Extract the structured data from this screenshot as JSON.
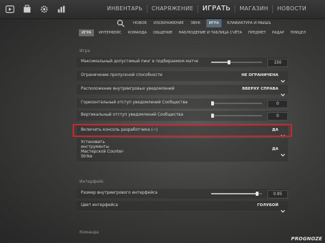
{
  "topbar": {
    "icons": [
      "play-icon",
      "inventory-box-icon",
      "gear-icon",
      "chart-icon"
    ],
    "nav": [
      "ИНВЕНТАРЬ",
      "СНАРЯЖЕНИЕ",
      "ИГРАТЬ",
      "МАГАЗИН",
      "НОВОСТИ"
    ]
  },
  "subtabs": [
    "НОВОЕ",
    "ИЗОБРАЖЕНИЕ",
    "ЗВУК",
    "ИГРА",
    "КЛАВИАТУРА И МЫШЬ"
  ],
  "cattabs": [
    "ИГРА",
    "ИНТЕРФЕЙС",
    "КОМАНДА",
    "ОБЩЕНИЕ",
    "НАБЛЮДЕНИЕ И ТАБЛИЦА СЧЁТА",
    "ПРЕДМЕТ",
    "РАДАР",
    "ПРИЦЕЛ"
  ],
  "sections": {
    "game": "Игра",
    "interface": "Интерфейс",
    "team": "Команда"
  },
  "rows": {
    "max_ping": {
      "label": "Максимальный допустимый пинг в подбираемом матче",
      "value": "150",
      "fraction": 0.35
    },
    "bandwidth": {
      "label": "Ограничение пропускной способности",
      "value": "НЕ ОГРАНИЧЕНА"
    },
    "notif_pos": {
      "label": "Расположение внутриигровых уведомлений",
      "value": "ВВЕРХУ СПРАВА"
    },
    "h_offset": {
      "label": "Горизонтальный отступ уведомлений Сообщества",
      "value": "0",
      "fraction": 0.0
    },
    "v_offset": {
      "label": "Вертикальный отступ уведомлений Сообщества",
      "value": "0",
      "fraction": 0.0
    },
    "dev_console": {
      "label": "Включить консоль разработчика (~)",
      "value": "ДА"
    },
    "install_tools": {
      "label_lines": [
        "Установить",
        "инструменты",
        "Мастерской Counter-",
        "Strike"
      ],
      "value": "ДА"
    },
    "hud_size": {
      "label": "Размер внутриигрового интерфейса",
      "value": "0.95",
      "fraction": 0.9
    },
    "hud_color": {
      "label": "Цвет интерфейса",
      "value": "ГОЛУБОЙ"
    }
  },
  "watermark": "PROGNOZE"
}
